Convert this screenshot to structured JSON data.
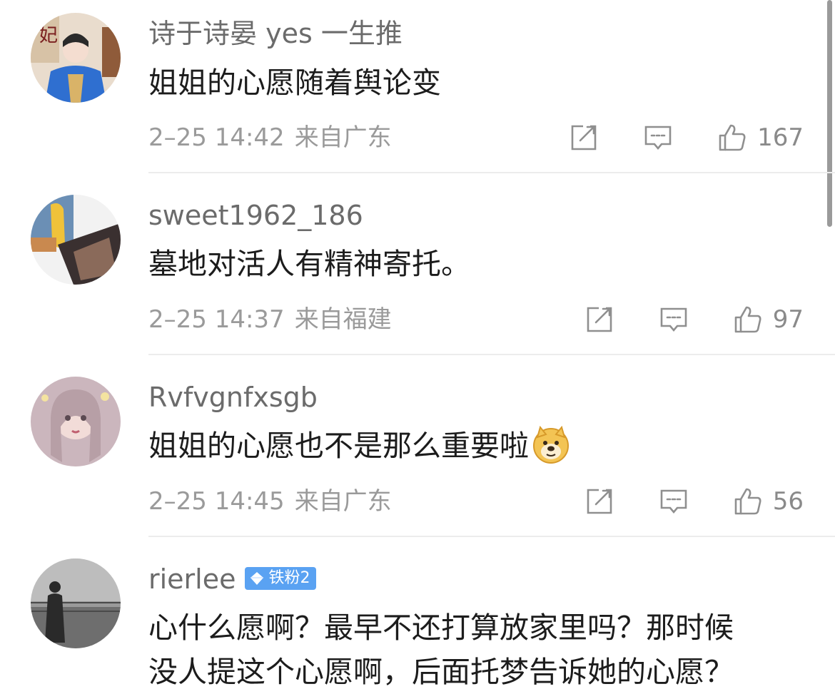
{
  "comments": [
    {
      "username": "诗于诗晏 yes 一生推",
      "text": "姐姐的心愿随着舆论变",
      "time": "2–25 14:42",
      "location": "来自广东",
      "likes": "167"
    },
    {
      "username": "sweet1962_186",
      "text": "墓地对活人有精神寄托。",
      "time": "2–25 14:37",
      "location": "来自福建",
      "likes": "97"
    },
    {
      "username": "Rvfvgnfxsgb",
      "text": "姐姐的心愿也不是那么重要啦",
      "time": "2–25 14:45",
      "location": "来自广东",
      "likes": "56",
      "emoji": "doge-emoji"
    },
    {
      "username": "rierlee",
      "badge": "铁粉2",
      "text_line1": "心什么愿啊？最早不还打算放家里吗？那时候",
      "text_line2": "没人提这个心愿啊，后面托梦告诉她的心愿？"
    }
  ],
  "icons": {
    "share": "share-icon",
    "reply": "comment-icon",
    "like": "thumbs-up-icon"
  },
  "colors": {
    "badge": "#5aa2f2",
    "text": "#1c1c1c",
    "meta": "#9a9a9a"
  }
}
